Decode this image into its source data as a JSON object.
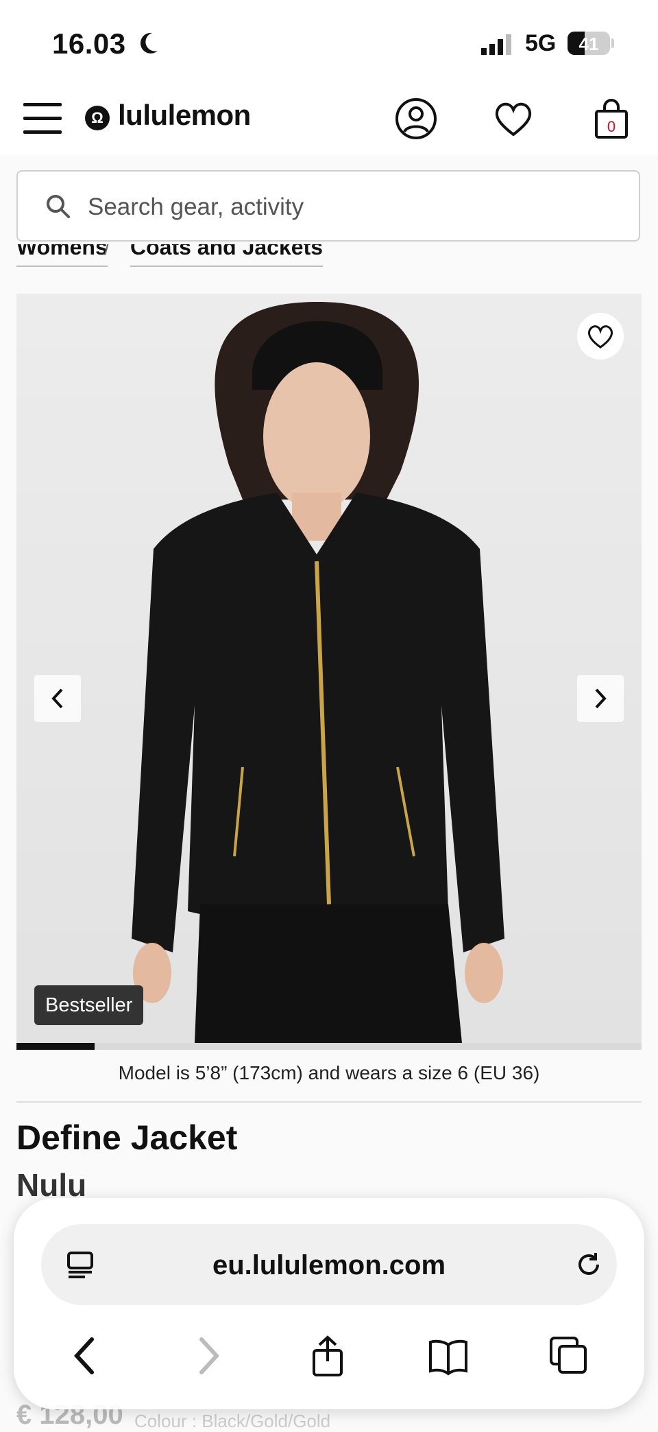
{
  "status_bar": {
    "time": "16.03",
    "network": "5G",
    "battery_percent": "41",
    "battery_level": 0.41
  },
  "header": {
    "brand": "lululemon",
    "bag_count": "0"
  },
  "search": {
    "placeholder": "Search gear, activity"
  },
  "breadcrumb": [
    {
      "label": "Womens"
    },
    {
      "label": "Coats and Jackets"
    }
  ],
  "gallery": {
    "badge": "Bestseller",
    "progress_fraction": 0.125,
    "model_note": "Model is 5’8” (173cm) and wears a size 6 (EU 36)"
  },
  "product": {
    "name": "Define Jacket",
    "subname": "Nulu",
    "price": "€ 128,00",
    "colour": "Colour : Black/Gold/Gold"
  },
  "browser": {
    "url": "eu.lululemon.com"
  }
}
